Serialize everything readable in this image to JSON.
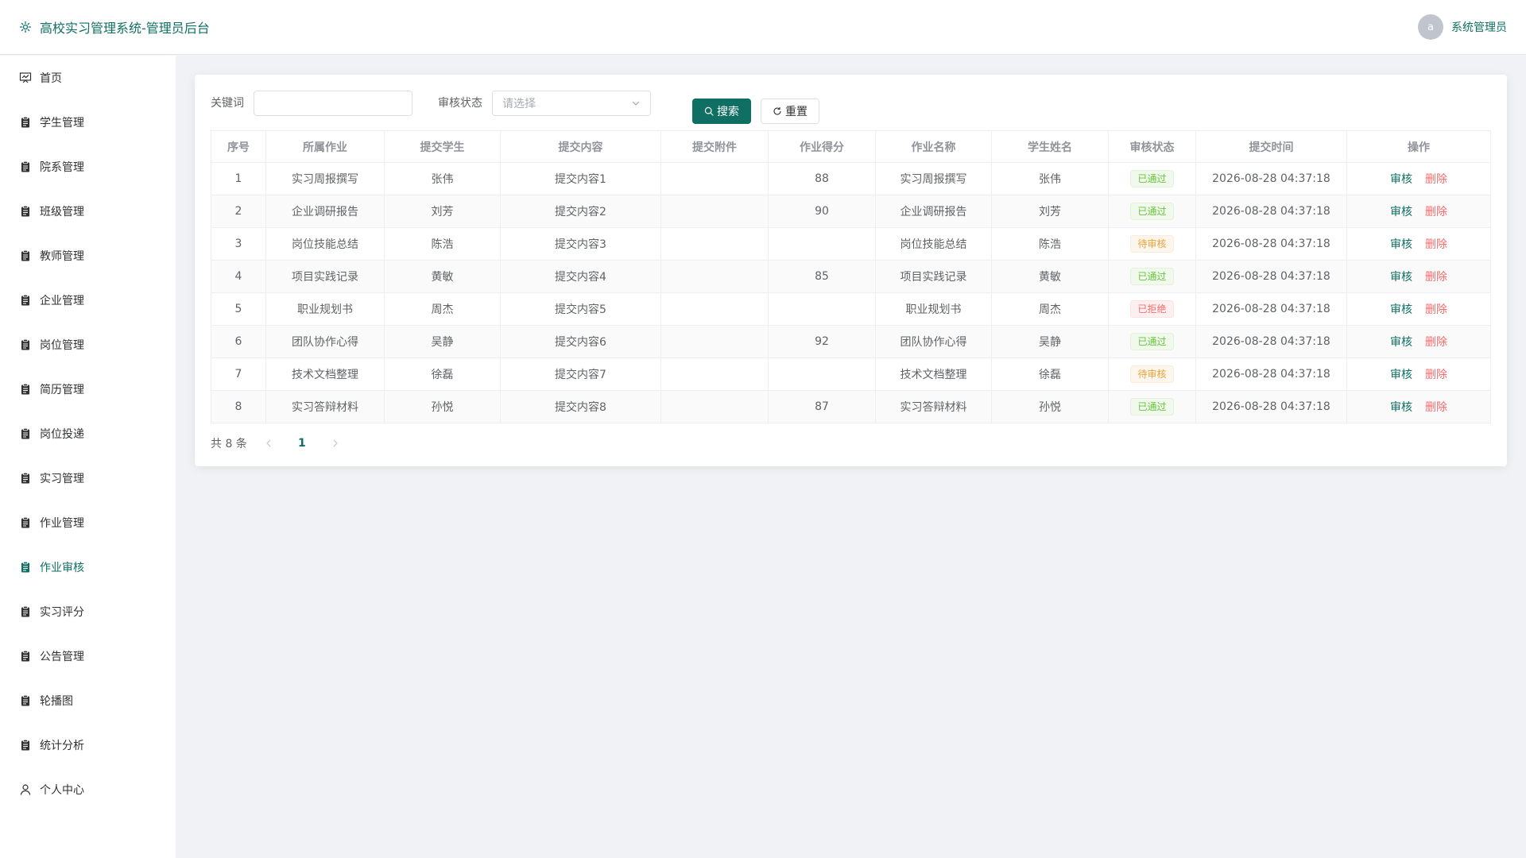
{
  "header": {
    "title": "高校实习管理系统-管理员后台",
    "avatar_letter": "a",
    "user_name": "系统管理员"
  },
  "sidebar": {
    "items": [
      {
        "label": "首页",
        "icon": "dashboard-icon"
      },
      {
        "label": "学生管理",
        "icon": "clipboard-icon"
      },
      {
        "label": "院系管理",
        "icon": "clipboard-icon"
      },
      {
        "label": "班级管理",
        "icon": "clipboard-icon"
      },
      {
        "label": "教师管理",
        "icon": "clipboard-icon"
      },
      {
        "label": "企业管理",
        "icon": "clipboard-icon"
      },
      {
        "label": "岗位管理",
        "icon": "clipboard-icon"
      },
      {
        "label": "简历管理",
        "icon": "clipboard-icon"
      },
      {
        "label": "岗位投递",
        "icon": "clipboard-icon"
      },
      {
        "label": "实习管理",
        "icon": "clipboard-icon"
      },
      {
        "label": "作业管理",
        "icon": "clipboard-icon"
      },
      {
        "label": "作业审核",
        "icon": "clipboard-icon"
      },
      {
        "label": "实习评分",
        "icon": "clipboard-icon"
      },
      {
        "label": "公告管理",
        "icon": "clipboard-icon"
      },
      {
        "label": "轮播图",
        "icon": "clipboard-icon"
      },
      {
        "label": "统计分析",
        "icon": "clipboard-icon"
      },
      {
        "label": "个人中心",
        "icon": "user-icon"
      }
    ],
    "active_index": 11
  },
  "search": {
    "keyword_label": "关键词",
    "keyword_value": "",
    "status_label": "审核状态",
    "status_placeholder": "请选择",
    "search_button": "搜索",
    "reset_button": "重置"
  },
  "table": {
    "columns": [
      "序号",
      "所属作业",
      "提交学生",
      "提交内容",
      "提交附件",
      "作业得分",
      "作业名称",
      "学生姓名",
      "审核状态",
      "提交时间",
      "操作"
    ],
    "rows": [
      {
        "no": "1",
        "assignment": "实习周报撰写",
        "student": "张伟",
        "content": "提交内容1",
        "attachment": "",
        "score": "88",
        "name": "实习周报撰写",
        "student_name": "张伟",
        "status": "已通过",
        "status_type": "success",
        "time": "2026-08-28 04:37:18"
      },
      {
        "no": "2",
        "assignment": "企业调研报告",
        "student": "刘芳",
        "content": "提交内容2",
        "attachment": "",
        "score": "90",
        "name": "企业调研报告",
        "student_name": "刘芳",
        "status": "已通过",
        "status_type": "success",
        "time": "2026-08-28 04:37:18"
      },
      {
        "no": "3",
        "assignment": "岗位技能总结",
        "student": "陈浩",
        "content": "提交内容3",
        "attachment": "",
        "score": "",
        "name": "岗位技能总结",
        "student_name": "陈浩",
        "status": "待审核",
        "status_type": "warning",
        "time": "2026-08-28 04:37:18"
      },
      {
        "no": "4",
        "assignment": "项目实践记录",
        "student": "黄敏",
        "content": "提交内容4",
        "attachment": "",
        "score": "85",
        "name": "项目实践记录",
        "student_name": "黄敏",
        "status": "已通过",
        "status_type": "success",
        "time": "2026-08-28 04:37:18"
      },
      {
        "no": "5",
        "assignment": "职业规划书",
        "student": "周杰",
        "content": "提交内容5",
        "attachment": "",
        "score": "",
        "name": "职业规划书",
        "student_name": "周杰",
        "status": "已拒绝",
        "status_type": "danger",
        "time": "2026-08-28 04:37:18"
      },
      {
        "no": "6",
        "assignment": "团队协作心得",
        "student": "吴静",
        "content": "提交内容6",
        "attachment": "",
        "score": "92",
        "name": "团队协作心得",
        "student_name": "吴静",
        "status": "已通过",
        "status_type": "success",
        "time": "2026-08-28 04:37:18"
      },
      {
        "no": "7",
        "assignment": "技术文档整理",
        "student": "徐磊",
        "content": "提交内容7",
        "attachment": "",
        "score": "",
        "name": "技术文档整理",
        "student_name": "徐磊",
        "status": "待审核",
        "status_type": "warning",
        "time": "2026-08-28 04:37:18"
      },
      {
        "no": "8",
        "assignment": "实习答辩材料",
        "student": "孙悦",
        "content": "提交内容8",
        "attachment": "",
        "score": "87",
        "name": "实习答辩材料",
        "student_name": "孙悦",
        "status": "已通过",
        "status_type": "success",
        "time": "2026-08-28 04:37:18"
      }
    ],
    "op_review": "审核",
    "op_delete": "删除"
  },
  "pagination": {
    "total_text": "共 8 条",
    "current_page": "1"
  },
  "colors": {
    "accent": "#0f6f63",
    "danger": "#f56c6c",
    "success": "#67c23a",
    "warning": "#e6a23c"
  }
}
